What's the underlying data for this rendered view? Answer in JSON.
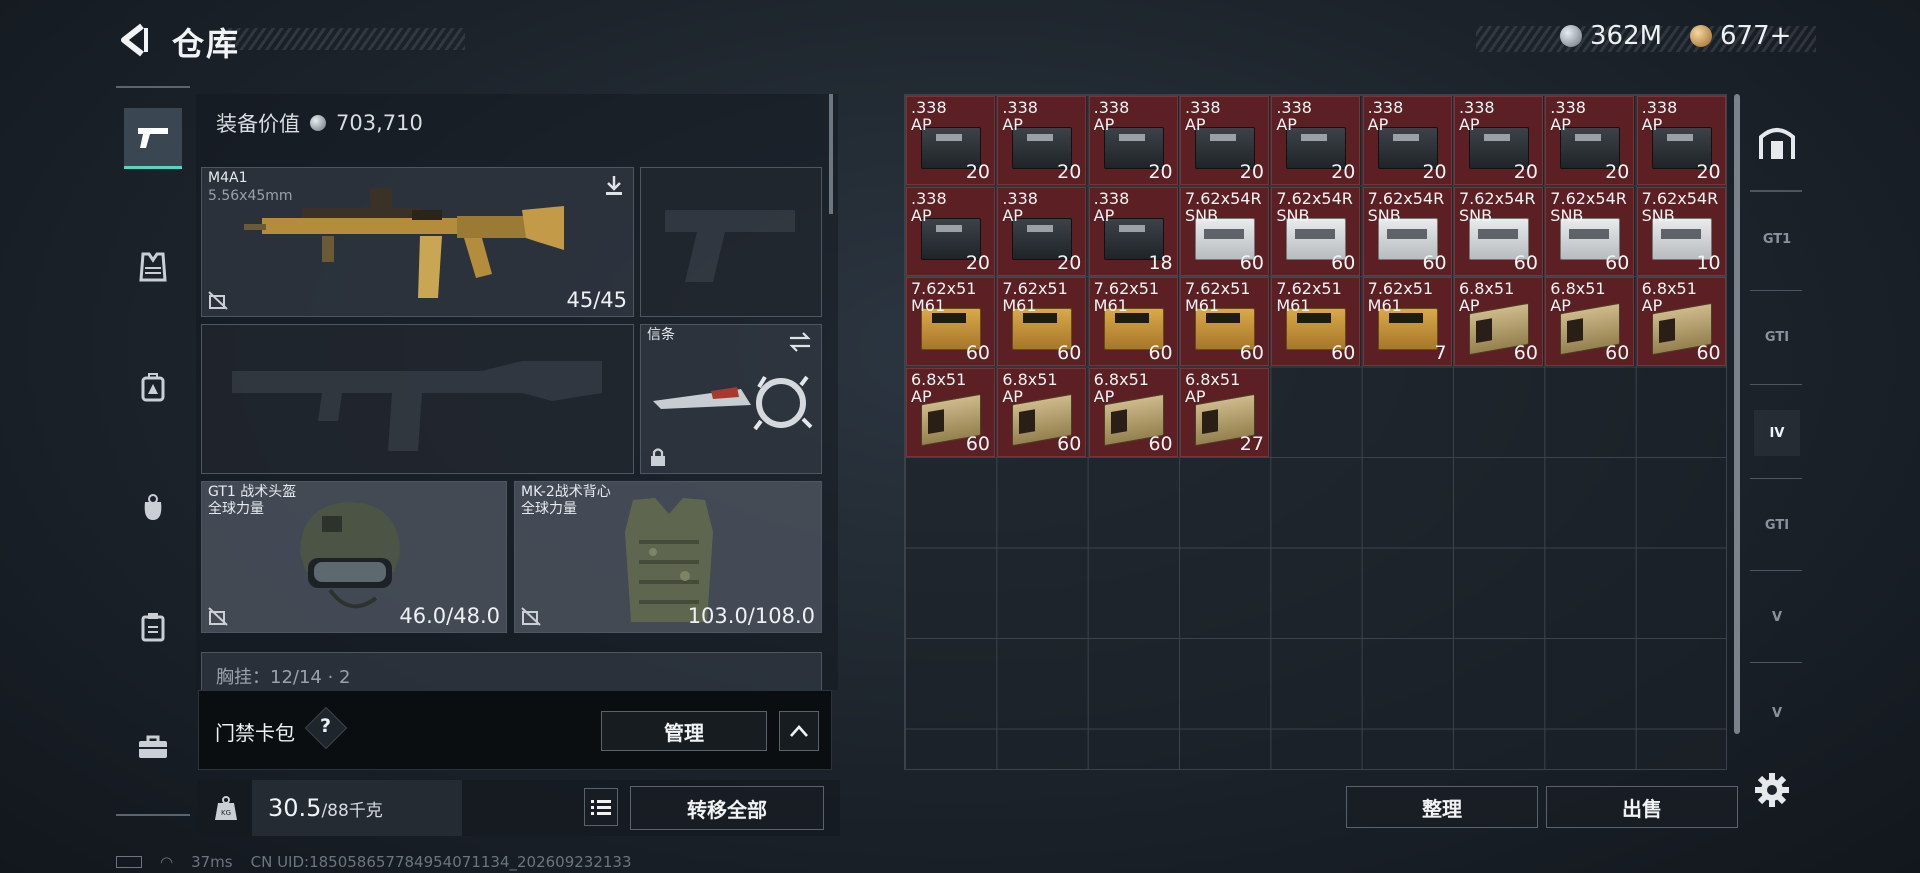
{
  "header": {
    "title": "仓库",
    "currency_silver": "362M",
    "currency_gold": "677+"
  },
  "loadout": {
    "equipment_value_label": "装备价值",
    "equipment_value": "703,710",
    "primary": {
      "name": "M4A1",
      "caliber": "5.56x45mm",
      "ammo": "45/45"
    },
    "melee_label": "信条",
    "helmet": {
      "name": "GT1 战术头盔",
      "brand": "全球力量",
      "durability": "46.0/48.0"
    },
    "armor": {
      "name": "MK-2战术背心",
      "brand": "全球力量",
      "durability": "103.0/108.0"
    },
    "chest_rig_partial": "胸挂：12/14 · 2"
  },
  "card_pack": {
    "label": "门禁卡包",
    "help": "?",
    "manage_button": "管理",
    "collapse_icon": "chevron-up-icon"
  },
  "weight": {
    "current": "30.5",
    "max": "/88千克",
    "transfer_all_button": "转移全部"
  },
  "stash": {
    "sort_button": "整理",
    "sell_button": "出售",
    "items": [
      {
        "name": ".338\nAP",
        "count": "20",
        "kind": "ap338"
      },
      {
        "name": ".338\nAP",
        "count": "20",
        "kind": "ap338"
      },
      {
        "name": ".338\nAP",
        "count": "20",
        "kind": "ap338"
      },
      {
        "name": ".338\nAP",
        "count": "20",
        "kind": "ap338"
      },
      {
        "name": ".338\nAP",
        "count": "20",
        "kind": "ap338"
      },
      {
        "name": ".338\nAP",
        "count": "20",
        "kind": "ap338"
      },
      {
        "name": ".338\nAP",
        "count": "20",
        "kind": "ap338"
      },
      {
        "name": ".338\nAP",
        "count": "20",
        "kind": "ap338"
      },
      {
        "name": ".338\nAP",
        "count": "20",
        "kind": "ap338"
      },
      {
        "name": ".338\nAP",
        "count": "20",
        "kind": "ap338"
      },
      {
        "name": ".338\nAP",
        "count": "20",
        "kind": "ap338"
      },
      {
        "name": ".338\nAP",
        "count": "18",
        "kind": "ap338"
      },
      {
        "name": "7.62x54R\nSNB",
        "count": "60",
        "kind": "snb"
      },
      {
        "name": "7.62x54R\nSNB",
        "count": "60",
        "kind": "snb"
      },
      {
        "name": "7.62x54R\nSNB",
        "count": "60",
        "kind": "snb"
      },
      {
        "name": "7.62x54R\nSNB",
        "count": "60",
        "kind": "snb"
      },
      {
        "name": "7.62x54R\nSNB",
        "count": "60",
        "kind": "snb"
      },
      {
        "name": "7.62x54R\nSNB",
        "count": "10",
        "kind": "snb"
      },
      {
        "name": "7.62x51\nM61",
        "count": "60",
        "kind": "m61"
      },
      {
        "name": "7.62x51\nM61",
        "count": "60",
        "kind": "m61"
      },
      {
        "name": "7.62x51\nM61",
        "count": "60",
        "kind": "m61"
      },
      {
        "name": "7.62x51\nM61",
        "count": "60",
        "kind": "m61"
      },
      {
        "name": "7.62x51\nM61",
        "count": "60",
        "kind": "m61"
      },
      {
        "name": "7.62x51\nM61",
        "count": "7",
        "kind": "m61"
      },
      {
        "name": "6.8x51\nAP",
        "count": "60",
        "kind": "ap68"
      },
      {
        "name": "6.8x51\nAP",
        "count": "60",
        "kind": "ap68"
      },
      {
        "name": "6.8x51\nAP",
        "count": "60",
        "kind": "ap68"
      },
      {
        "name": "6.8x51\nAP",
        "count": "60",
        "kind": "ap68"
      },
      {
        "name": "6.8x51\nAP",
        "count": "60",
        "kind": "ap68"
      },
      {
        "name": "6.8x51\nAP",
        "count": "60",
        "kind": "ap68"
      },
      {
        "name": "6.8x51\nAP",
        "count": "27",
        "kind": "ap68"
      }
    ]
  },
  "rail": {
    "items": [
      "GT1",
      "GTI",
      "IV",
      "GTI",
      "V",
      "V"
    ]
  },
  "status": {
    "ping": "37ms",
    "uid": "CN UID:18505865778495407113​4_202609232133"
  },
  "colors": {
    "accent": "#55d6c0",
    "stash_item_bg": "#5b1f24"
  }
}
